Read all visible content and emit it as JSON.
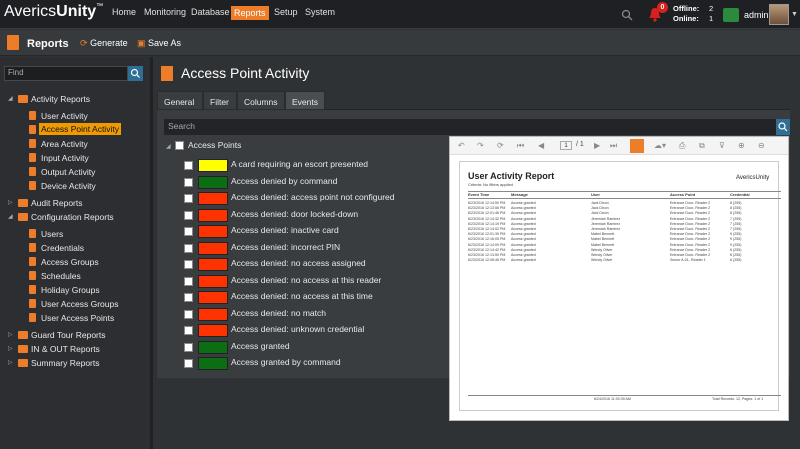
{
  "app": {
    "brand_part1": "Averics",
    "brand_part2": "Unity",
    "brand_tm": "™"
  },
  "nav": [
    "Home",
    "Monitoring",
    "Database",
    "Reports",
    "Setup",
    "System"
  ],
  "notifications": {
    "count": "0"
  },
  "status": {
    "offline_label": "Offline:",
    "offline_value": "2",
    "online_label": "Online:",
    "online_value": "1"
  },
  "user": {
    "name": "admin"
  },
  "reportbar": {
    "title": "Reports",
    "generate": "Generate",
    "save_as": "Save As"
  },
  "sidebar": {
    "search_placeholder": "Find",
    "activity_group": "Activity Reports",
    "activity_items": [
      "User Activity",
      "Access Point Activity",
      "Area Activity",
      "Input Activity",
      "Output Activity",
      "Device Activity"
    ],
    "audit": "Audit Reports",
    "config_group": "Configuration Reports",
    "config_items": [
      "Users",
      "Credentials",
      "Access Groups",
      "Schedules",
      "Holiday Groups",
      "User Access Groups",
      "User Access Points"
    ],
    "guard": "Guard Tour Reports",
    "inout": "IN & OUT Reports",
    "summary": "Summary Reports"
  },
  "main": {
    "title": "Access Point Activity",
    "tabs": [
      "General",
      "Filter",
      "Columns",
      "Events"
    ],
    "search_placeholder": "Search",
    "root_label": "Access Points",
    "events": [
      {
        "label": "A card requiring an escort presented",
        "color": "#ffff00"
      },
      {
        "label": "Access denied by command",
        "color": "#0b6e12"
      },
      {
        "label": "Access denied: access point not configured",
        "color": "#ff3300"
      },
      {
        "label": "Access denied: door locked-down",
        "color": "#ff3300"
      },
      {
        "label": "Access denied: inactive card",
        "color": "#ff3300"
      },
      {
        "label": "Access denied: incorrect PIN",
        "color": "#ff3300"
      },
      {
        "label": "Access denied: no access assigned",
        "color": "#ff3300"
      },
      {
        "label": "Access denied: no access at this reader",
        "color": "#ff3300"
      },
      {
        "label": "Access denied: no access at this time",
        "color": "#ff3300"
      },
      {
        "label": "Access denied: no match",
        "color": "#ff3300"
      },
      {
        "label": "Access denied: unknown credential",
        "color": "#ff3300"
      },
      {
        "label": "Access granted",
        "color": "#0b6e12"
      },
      {
        "label": "Access granted by command",
        "color": "#0b6e12"
      }
    ]
  },
  "preview": {
    "page_value": "1",
    "page_of": "/ 1",
    "report_title": "User Activity Report",
    "criteria": "Criteria:    No filters applied",
    "logo": "AvericsUnity",
    "headers": [
      "Event Time",
      "Message",
      "User",
      "Access Point",
      "Credential"
    ],
    "rows": [
      [
        "6/23/2016 12:14:50 PM",
        "Access granted",
        "Jack Dixon",
        "Entrance Door- Reader 2",
        "8 (255)"
      ],
      [
        "6/23/2016 12:13:56 PM",
        "Access granted",
        "Jack Dixon",
        "Entrance Door- Reader 2",
        "8 (255)"
      ],
      [
        "6/23/2016 12:01:46 PM",
        "Access granted",
        "Jack Dixon",
        "Entrance Door- Reader 2",
        "8 (255)"
      ],
      [
        "6/23/2016 12:14:32 PM",
        "Access granted",
        "Jeremiah Ramirez",
        "Entrance Door- Reader 2",
        "7 (255)"
      ],
      [
        "6/23/2016 12:14:19 PM",
        "Access granted",
        "Jeremiah Ramirez",
        "Entrance Door- Reader 2",
        "7 (255)"
      ],
      [
        "6/23/2016 12:14:02 PM",
        "Access granted",
        "Jeremiah Ramirez",
        "Entrance Door- Reader 2",
        "7 (255)"
      ],
      [
        "6/23/2016 12:01:39 PM",
        "Access granted",
        "Mabel Bennett",
        "Entrance Door- Reader 2",
        "9 (255)"
      ],
      [
        "6/23/2016 12:16:05 PM",
        "Access granted",
        "Mabel Bennett",
        "Entrance Door- Reader 2",
        "9 (255)"
      ],
      [
        "6/23/2016 12:14:09 PM",
        "Access granted",
        "Mabel Bennett",
        "Entrance Door- Reader 2",
        "9 (255)"
      ],
      [
        "6/23/2016 12:14:42 PM",
        "Access granted",
        "Wendy Oliver",
        "Entrance Door- Reader 2",
        "6 (255)"
      ],
      [
        "6/23/2016 12:13:50 PM",
        "Access granted",
        "Wendy Oliver",
        "Entrance Door- Reader 2",
        "6 (255)"
      ],
      [
        "6/23/2016 12:08:46 PM",
        "Access granted",
        "Wendy Oliver",
        "Sector A-01- Reader 1",
        "6 (255)"
      ]
    ],
    "footer_date": "6/24/2016 11:00:39 AM",
    "footer_total": "Total Records: 12, Pages: 1 of 1"
  }
}
